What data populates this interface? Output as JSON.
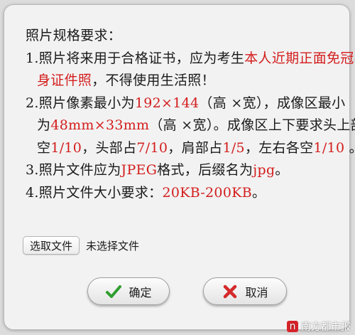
{
  "requirements": {
    "title": "照片规格要求：",
    "item1": {
      "prefix": "1.照片将来用于合格证书，应为考生",
      "highlight_a": "本人近期正面免冠半",
      "highlight_b": "身证件照",
      "suffix": "，不得使用生活照！"
    },
    "item2": {
      "prefix": "2.照片像素最小为",
      "pixels": "192×144",
      "mid": "（高 ×宽），成像区最小",
      "lead": "为",
      "size_mm": "48mm×33mm",
      "tail": "（高 ×宽）。成像区上下要求头上部",
      "lead3": "空",
      "frac_top": "1/10",
      "head_text": "，头部占",
      "frac_head": "7/10",
      "shoulder_text": "，肩部占",
      "frac_shoulder": "1/5",
      "side_text": "，左右各空",
      "frac_side": "1/10",
      "end": " 。"
    },
    "item3": {
      "prefix": "3.照片文件应为",
      "format": "JPEG",
      "mid": "格式，后缀名为",
      "ext": "jpg",
      "end": "。"
    },
    "item4": {
      "prefix": "4.照片文件大小要求：",
      "size": "20KB-200KB",
      "end": "。"
    }
  },
  "file_input": {
    "button_label": "选取文件",
    "status": "未选择文件"
  },
  "buttons": {
    "ok_label": "确定",
    "cancel_label": "取消"
  },
  "watermark": {
    "logo_text": "n",
    "text": "南方都市报"
  },
  "colors": {
    "highlight": "#d41d1d",
    "check": "#2e9e2e",
    "cross": "#d42a2a",
    "dialog_bg": "#f2f2f2"
  },
  "icons": {
    "ok": "check-icon",
    "cancel": "cross-icon"
  }
}
